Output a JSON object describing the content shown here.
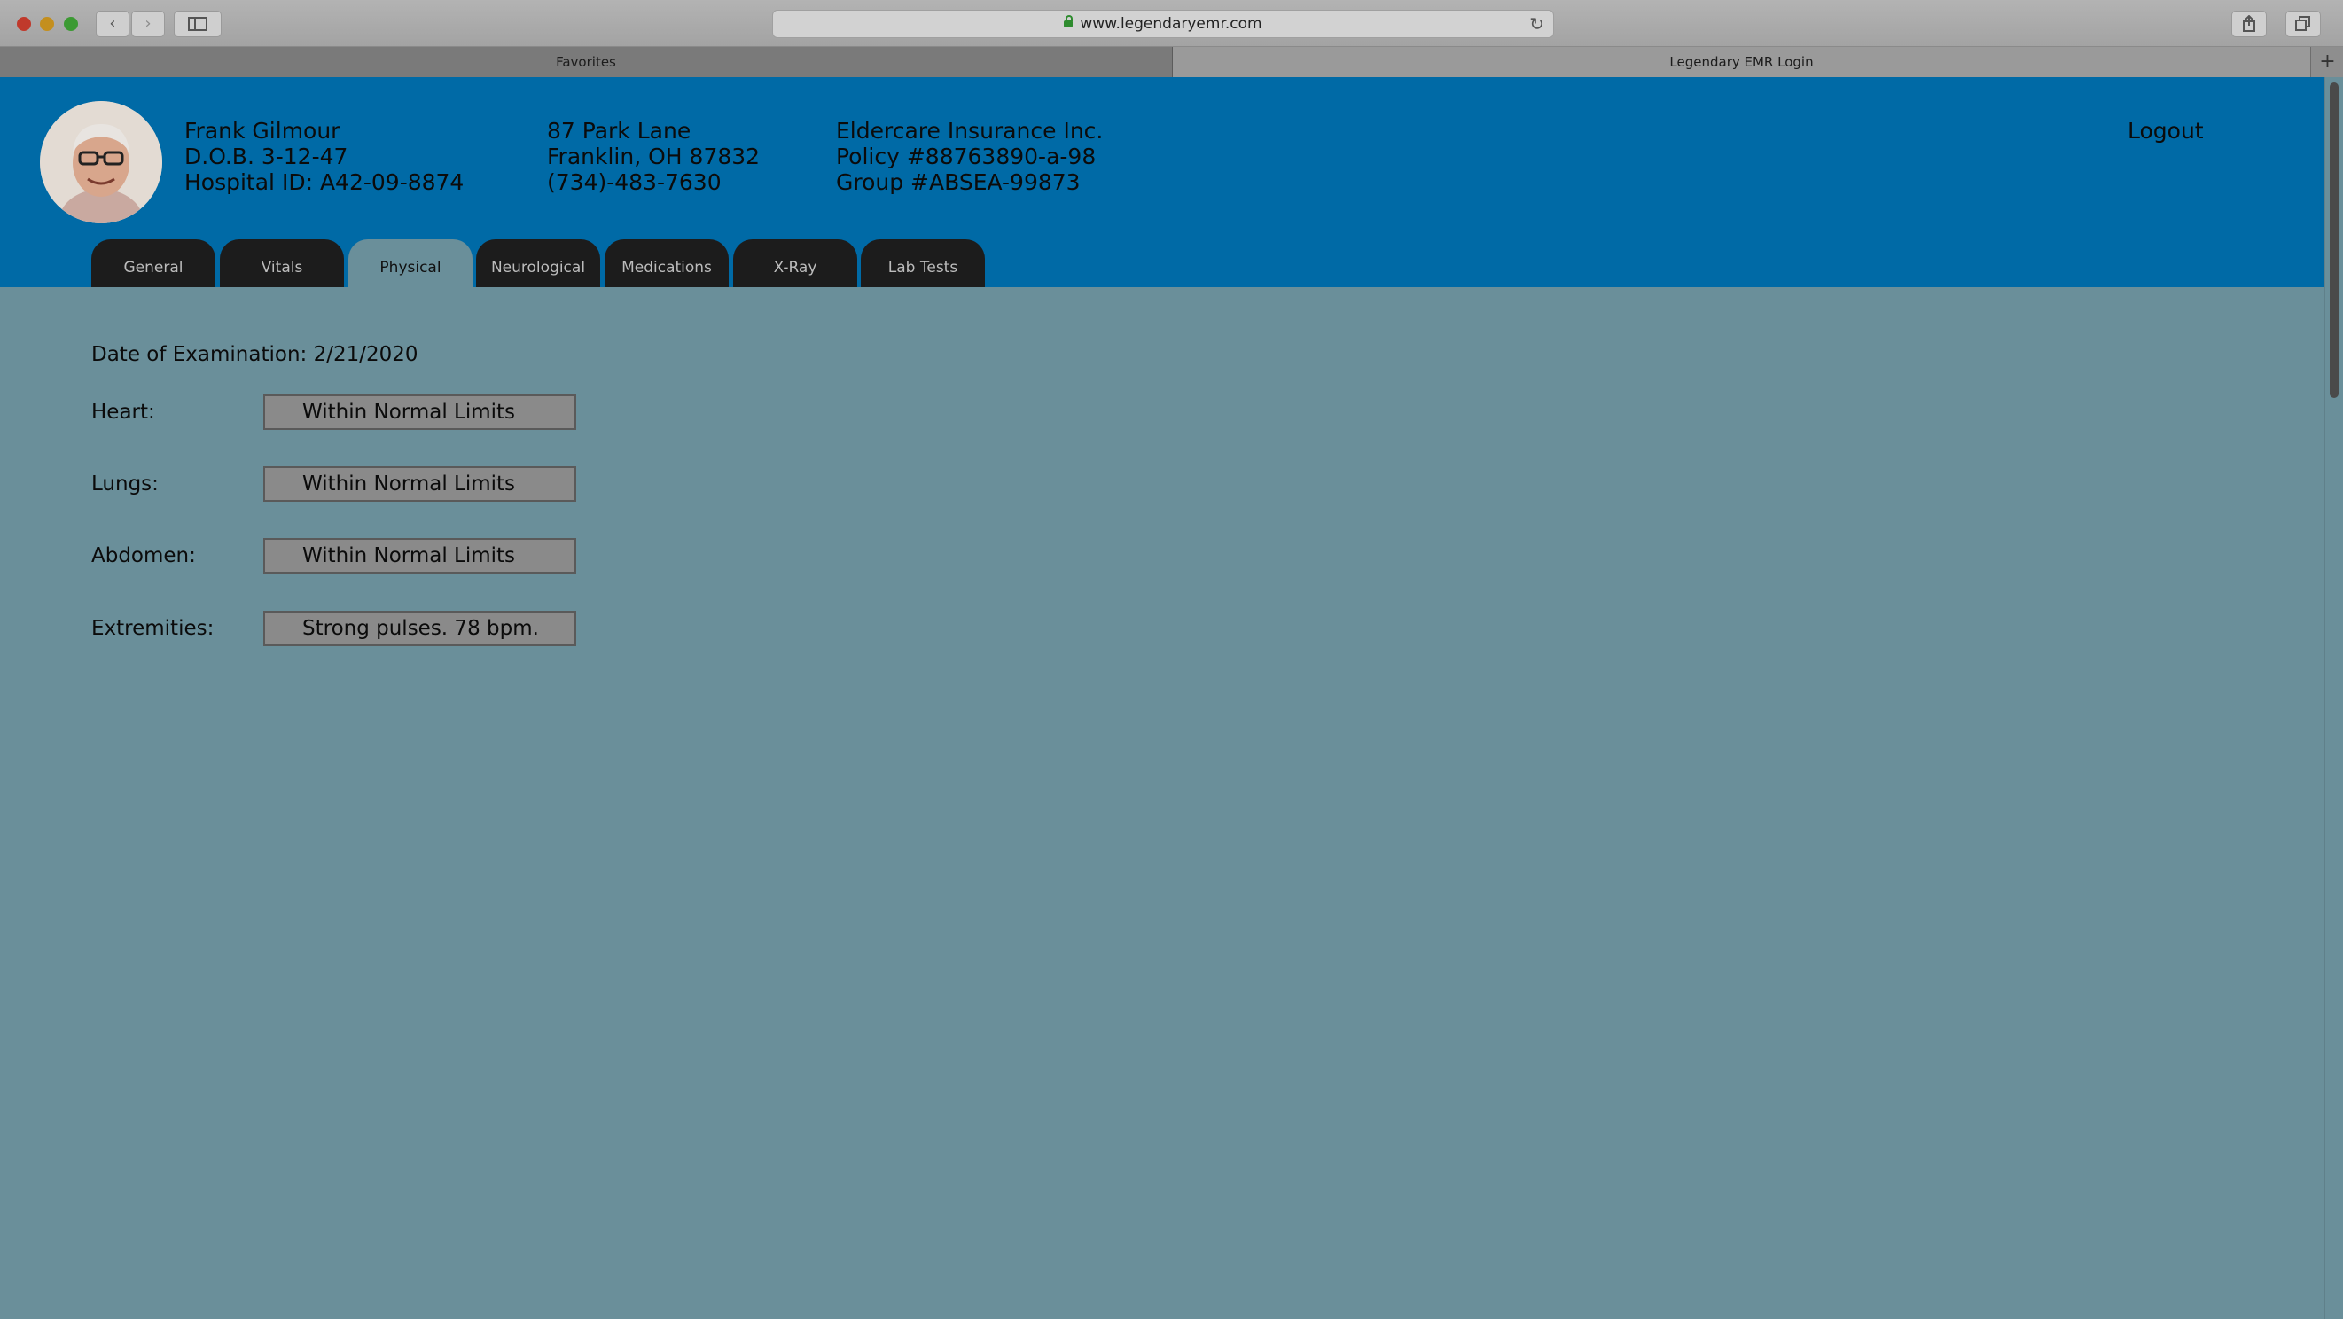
{
  "browser": {
    "url": "www.legendaryemr.com",
    "tabs": [
      "Favorites",
      "Legendary EMR Login"
    ],
    "new_tab_label": "+"
  },
  "patient": {
    "name": "Frank Gilmour",
    "dob": "D.O.B. 3-12-47",
    "hospital_id": "Hospital ID: A42-09-8874",
    "address_line1": "87 Park Lane",
    "address_line2": "Franklin, OH 87832",
    "phone": "(734)-483-7630",
    "insurer": "Eldercare Insurance Inc.",
    "policy": "Policy #88763890-a-98",
    "group": "Group #ABSEA-99873"
  },
  "header": {
    "logout_label": "Logout"
  },
  "emr_tabs": [
    {
      "label": "General",
      "active": false
    },
    {
      "label": "Vitals",
      "active": false
    },
    {
      "label": "Physical",
      "active": true
    },
    {
      "label": "Neurological",
      "active": false
    },
    {
      "label": "Medications",
      "active": false
    },
    {
      "label": "X-Ray",
      "active": false
    },
    {
      "label": "Lab Tests",
      "active": false
    }
  ],
  "physical": {
    "exam_date": "Date of Examination: 2/21/2020",
    "rows": [
      {
        "label": "Heart:",
        "value": "Within Normal Limits"
      },
      {
        "label": "Lungs:",
        "value": "Within Normal Limits"
      },
      {
        "label": "Abdomen:",
        "value": "Within Normal Limits"
      },
      {
        "label": "Extremities:",
        "value": "Strong pulses. 78 bpm."
      }
    ]
  },
  "colors": {
    "header_bg": "#006aa6",
    "content_bg": "#6a8f9a",
    "tab_dark": "#1c1c1c"
  }
}
